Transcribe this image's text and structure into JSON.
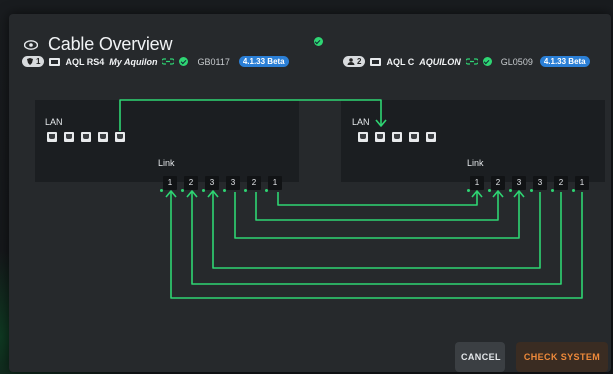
{
  "title": "Cable Overview",
  "colors": {
    "ok": "#2ed573",
    "version_badge": "#2b7fd6",
    "wire": "#2ed573",
    "check_text": "#f08a3a"
  },
  "devices": [
    {
      "badge": "1",
      "name": "AQL RS4",
      "alias": "My Aquilon",
      "serial": "GB0117",
      "version": "4.1.33 Beta"
    },
    {
      "badge": "2",
      "name": "AQL C",
      "alias": "AQUILON",
      "serial": "GL0509",
      "version": "4.1.33 Beta"
    }
  ],
  "panels": [
    {
      "lan_label": "LAN",
      "link_label": "Link",
      "link_ports": [
        "1",
        "2",
        "3",
        "3",
        "2",
        "1"
      ]
    },
    {
      "lan_label": "LAN",
      "link_label": "Link",
      "link_ports": [
        "1",
        "2",
        "3",
        "3",
        "2",
        "1"
      ]
    }
  ],
  "buttons": {
    "cancel": "CANCEL",
    "check": "CHECK SYSTEM"
  }
}
